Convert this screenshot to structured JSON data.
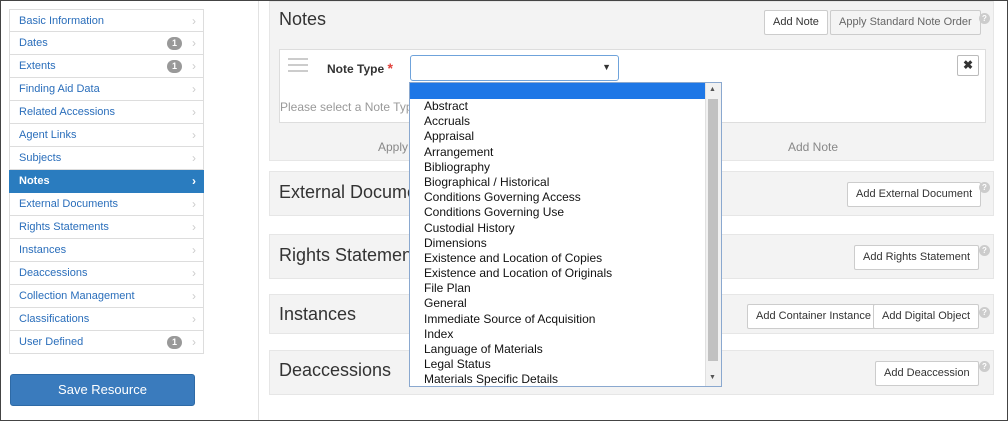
{
  "sidebar": {
    "items": [
      {
        "label": "Basic Information",
        "badge": ""
      },
      {
        "label": "Dates",
        "badge": "1"
      },
      {
        "label": "Extents",
        "badge": "1"
      },
      {
        "label": "Finding Aid Data",
        "badge": ""
      },
      {
        "label": "Related Accessions",
        "badge": ""
      },
      {
        "label": "Agent Links",
        "badge": ""
      },
      {
        "label": "Subjects",
        "badge": ""
      },
      {
        "label": "Notes",
        "badge": "",
        "active": true
      },
      {
        "label": "External Documents",
        "badge": ""
      },
      {
        "label": "Rights Statements",
        "badge": ""
      },
      {
        "label": "Instances",
        "badge": ""
      },
      {
        "label": "Deaccessions",
        "badge": ""
      },
      {
        "label": "Collection Management",
        "badge": ""
      },
      {
        "label": "Classifications",
        "badge": ""
      },
      {
        "label": "User Defined",
        "badge": "1"
      }
    ],
    "save_label": "Save Resource",
    "chevron": "›"
  },
  "notes": {
    "title": "Notes",
    "add_note": "Add Note",
    "apply_standard": "Apply Standard Note Order",
    "note_type_label": "Note Type",
    "required_mark": "*",
    "select_value": "",
    "hint": "Please select a Note Type",
    "close_glyph": "✖",
    "footer_apply": "Apply",
    "footer_add_note": "Add Note"
  },
  "external_documents": {
    "title": "External Documents",
    "button": "Add External Document"
  },
  "rights_statements": {
    "title": "Rights Statements",
    "button": "Add Rights Statement"
  },
  "instances": {
    "title": "Instances",
    "button_container": "Add Container Instance",
    "button_digital": "Add Digital Object"
  },
  "deaccessions": {
    "title": "Deaccessions",
    "button": "Add Deaccession"
  },
  "help_glyph": "?",
  "dropdown_options": [
    "Abstract",
    "Accruals",
    "Appraisal",
    "Arrangement",
    "Bibliography",
    "Biographical / Historical",
    "Conditions Governing Access",
    "Conditions Governing Use",
    "Custodial History",
    "Dimensions",
    "Existence and Location of Copies",
    "Existence and Location of Originals",
    "File Plan",
    "General",
    "Immediate Source of Acquisition",
    "Index",
    "Language of Materials",
    "Legal Status",
    "Materials Specific Details"
  ],
  "colors": {
    "accent": "#2a7cbf",
    "dropdown_highlight": "#1e77e6"
  }
}
